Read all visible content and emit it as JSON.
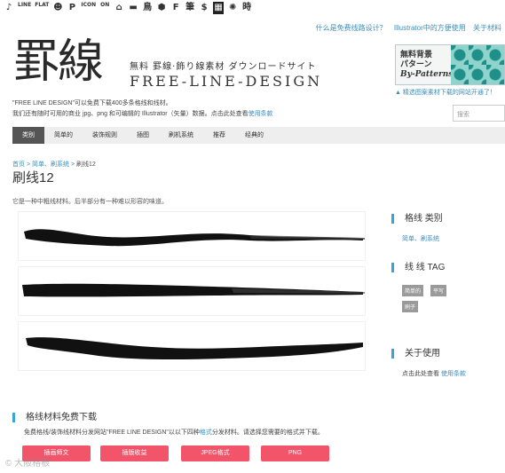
{
  "iconbar": [
    "♪",
    "LINE",
    "FLAT",
    "☻",
    "P",
    "ICON",
    "ON",
    "⌂",
    "▬",
    "鳥",
    "⬢",
    "F",
    "筆",
    "$",
    "▦",
    "✺",
    "時"
  ],
  "top_links": [
    "什么是免费线路设计？",
    "Illustrator中的方便使用",
    "关于材料"
  ],
  "logo": {
    "kanji": "罫線",
    "subtitle": "無料 罫線·飾り線素材 ダウンロードサイト",
    "english": "FREE-LINE-DESIGN"
  },
  "banner": {
    "line1": "無料背景",
    "line2": "パターン",
    "line3": "By-Patterns",
    "note": "▲ 精选图案素材下载的网站开通了！"
  },
  "intro": {
    "line1": "\"FREE LINE DESIGN\"可以免费下载400多条格线和线材。",
    "line2_prefix": "我们还有随时可用的商业 jpg、png 和可编辑的 Illustrator（矢量）数据。点击此处查看",
    "line2_link": "使用条款"
  },
  "search": {
    "placeholder": "搜索"
  },
  "nav": [
    "类别",
    "简单的",
    "装饰规则",
    "插图",
    "刷机系统",
    "推荐",
    "经典的"
  ],
  "breadcrumb": {
    "home": "首页",
    "sep1": ">",
    "cat": "简单、刷系统",
    "sep2": ">",
    "current": "刷线12"
  },
  "page_title": "刷线12",
  "description": "它是一种中粗线材料。后半部分有一种难以形容的味道。",
  "sidebar": {
    "category_title": "格线 类别",
    "category_links": "简单、刷系统",
    "tag_title": "线 线 TAG",
    "tags": [
      "简单的",
      "平写",
      "刷子"
    ],
    "about_title": "关于使用",
    "about_prefix": "点击此处查看",
    "about_link": "使用条款"
  },
  "download": {
    "title": "格线材料免费下载",
    "text_prefix": "免费格线/装饰线材料分发网站\"FREE LINE DESIGN\"以以下四种",
    "text_link": "格式",
    "text_suffix": "分发材料。请选择您需要的格式并下载。",
    "buttons": [
      "插画师文",
      "插版收益",
      "JPEG格式",
      "PNG"
    ]
  },
  "watermark": "© 大阪格根"
}
